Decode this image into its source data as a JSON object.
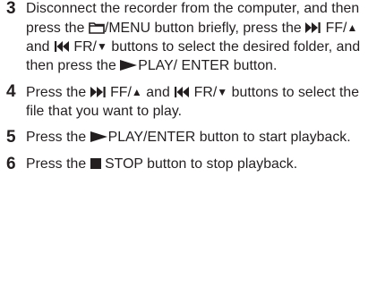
{
  "steps": [
    {
      "number": "3",
      "t1": "Disconnect the recorder from the computer, and then press the ",
      "t2": "/MENU button briefly, press the ",
      "t3": " FF/",
      "t4": " and ",
      "t5": " FR/",
      "t6": " buttons to select the desired folder, and then press the ",
      "t7": "PLAY/ ENTER button."
    },
    {
      "number": "4",
      "t1": "Press the ",
      "t2": " FF/",
      "t3": " and ",
      "t4": " FR/",
      "t5": " buttons to select the file that you want to play."
    },
    {
      "number": "5",
      "t1": "Press the ",
      "t2": "PLAY/ENTER button to start playback."
    },
    {
      "number": "6",
      "t1": "Press the ",
      "t2": " STOP button to stop playback."
    }
  ],
  "symbols": {
    "up_triangle": "▲",
    "down_triangle": "▼"
  },
  "icons": [
    "folder-icon",
    "fast-forward-icon",
    "rewind-icon",
    "play-icon",
    "stop-icon"
  ]
}
